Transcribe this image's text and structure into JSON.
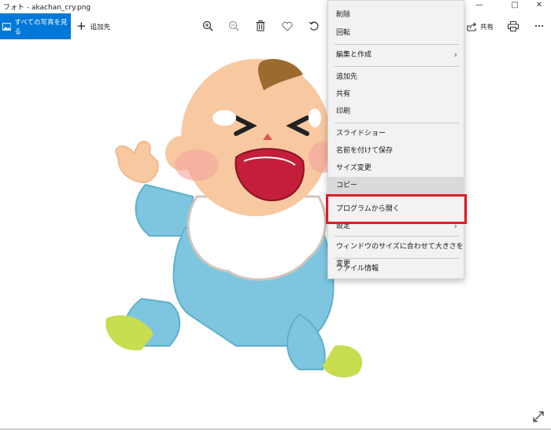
{
  "window": {
    "title": "フォト - akachan_cry.png"
  },
  "toolbar": {
    "all_photos_label": "すべての写真を見る",
    "add_to_label": "追加先",
    "share_label": "共有"
  },
  "context_menu": {
    "items": [
      "削除",
      "回転",
      "編集と作成",
      "追加先",
      "共有",
      "印刷",
      "スライドショー",
      "名前を付けて保存",
      "サイズ変更",
      "コピー",
      "プログラムから開く",
      "設定",
      "ウィンドウのサイズに合わせて大きさを変更",
      "ファイル情報"
    ]
  },
  "colors": {
    "accent": "#0078d7",
    "highlight_box": "#e01b24"
  },
  "icons": [
    "zoom-in-icon",
    "zoom-out-icon",
    "delete-icon",
    "heart-icon",
    "rotate-icon",
    "share-icon",
    "print-icon",
    "more-icon",
    "expand-icon"
  ]
}
